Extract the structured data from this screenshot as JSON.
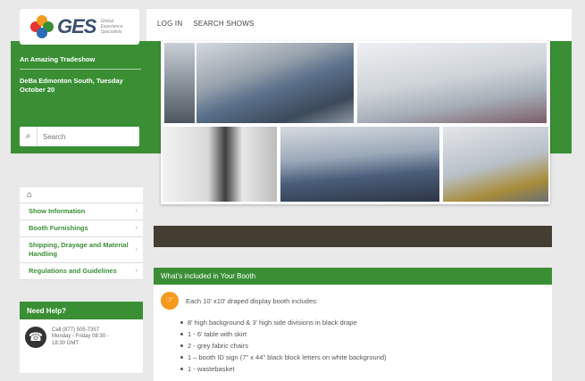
{
  "brand": {
    "name": "GES",
    "tagline": "Global Experience Specialists"
  },
  "topnav": {
    "login": "LOG IN",
    "search_shows": "SEARCH SHOWS"
  },
  "event": {
    "title": "An Amazing Tradeshow",
    "venue_date": "DeBa Edmonton South, Tuesday October 20"
  },
  "search": {
    "placeholder": "Search"
  },
  "sidenav": {
    "items": [
      {
        "label": "Show Information"
      },
      {
        "label": "Booth Furnishings"
      },
      {
        "label": "Shipping, Drayage and Material Handling"
      },
      {
        "label": "Regulations and Guidelines"
      }
    ]
  },
  "help": {
    "title": "Need Help?",
    "line1": "Call (877) 505-7357",
    "line2": "Monday - Friday 08:30 -",
    "line3": "18:30 GMT"
  },
  "booth": {
    "title": "What's included in Your Booth",
    "lead": "Each 10' x10' draped display booth includes:",
    "items": [
      "8' high background & 3' high side divisions in black drape",
      "1 - 6' table with skirt",
      "2 - grey fabric chairs",
      "1 – booth ID sign (7\" x 44\" black block letters on white background)",
      "1 - wastebasket"
    ]
  },
  "colors": {
    "green": "#3a8f34",
    "dark": "#433d32",
    "accent": "#f39a1f"
  }
}
